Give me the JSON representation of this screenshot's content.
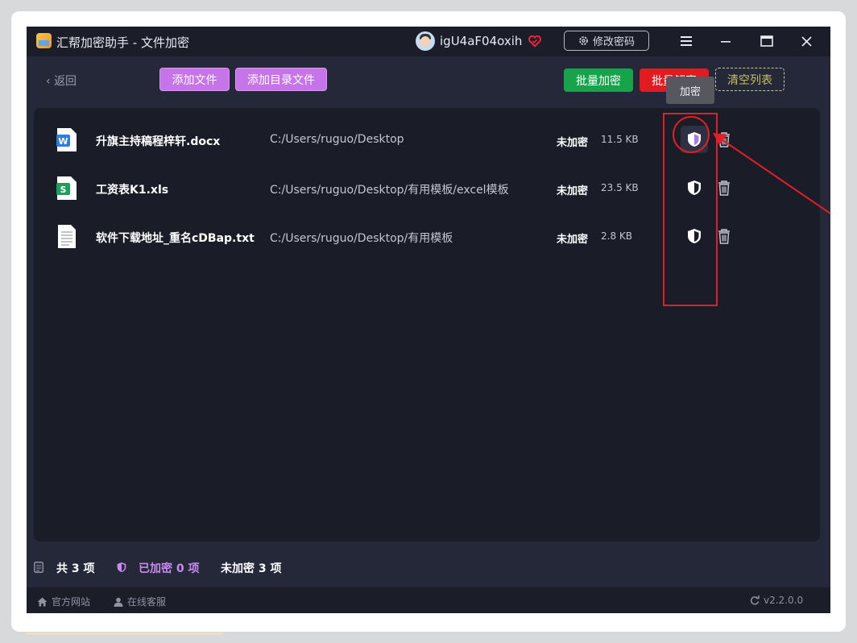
{
  "app": {
    "title": "汇帮加密助手 - 文件加密",
    "username": "igU4aF04oxih",
    "change_password_label": "修改密码"
  },
  "toolbar": {
    "back_label": "返回",
    "add_file_label": "添加文件",
    "add_folder_label": "添加目录文件",
    "batch_encrypt_label": "批量加密",
    "batch_decrypt_label": "批量解密",
    "clear_list_label": "清空列表"
  },
  "tooltip": {
    "text": "加密"
  },
  "files": [
    {
      "icon": "word-doc-icon",
      "name": "升旗主持稿程梓轩.docx",
      "path": "C:/Users/ruguo/Desktop",
      "status": "未加密",
      "size": "11.5 KB"
    },
    {
      "icon": "excel-sheet-icon",
      "name": "工资表K1.xls",
      "path": "C:/Users/ruguo/Desktop/有用模板/excel模板",
      "status": "未加密",
      "size": "23.5 KB"
    },
    {
      "icon": "text-file-icon",
      "name": "软件下载地址_重名cDBap.txt",
      "path": "C:/Users/ruguo/Desktop/有用模板",
      "status": "未加密",
      "size": "2.8 KB"
    }
  ],
  "summary": {
    "total_label": "共 3 项",
    "encrypted_label": "已加密 0 项",
    "unencrypted_label": "未加密 3 项"
  },
  "footer": {
    "website_label": "官方网站",
    "support_label": "在线客服",
    "version": "v2.2.0.0"
  },
  "colors": {
    "accent_purple": "#c574e9",
    "encrypt_green": "#16a34a",
    "decrypt_red": "#e21b21",
    "annotation_red": "#e01f26"
  }
}
